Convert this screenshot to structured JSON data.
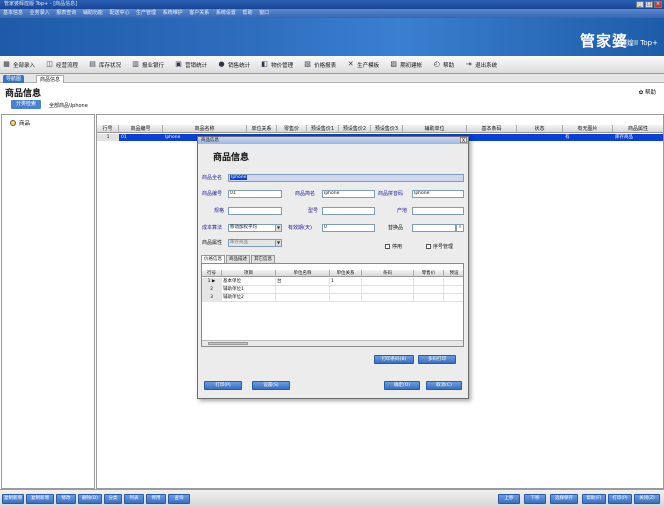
{
  "app": {
    "window_title": "管家婆辉煌版 Top+ - [商品信息]",
    "menu": [
      "基本信息",
      "业务录入",
      "报表查询",
      "辅助功能",
      "配送中心",
      "生产管理",
      "系统维护",
      "客户关系",
      "系统设置",
      "帮助",
      "窗口"
    ],
    "brand": "管家婆",
    "brand_sub": "辉煌II Top+"
  },
  "toolbar": [
    {
      "icon": "storefront-icon",
      "label": "全部录入"
    },
    {
      "icon": "chart-icon",
      "label": "经营流程"
    },
    {
      "icon": "warehouse-icon",
      "label": "库存状况"
    },
    {
      "icon": "ledger-icon",
      "label": "报业银行"
    },
    {
      "icon": "stats-icon",
      "label": "营销统计"
    },
    {
      "icon": "sales-icon",
      "label": "销售统计"
    },
    {
      "icon": "goods-icon",
      "label": "物价管理"
    },
    {
      "icon": "report-icon",
      "label": "价格报表"
    },
    {
      "icon": "tools-icon",
      "label": "生产模板"
    },
    {
      "icon": "calendar-icon",
      "label": "期初建帐"
    },
    {
      "icon": "clock-icon",
      "label": "帮助"
    },
    {
      "icon": "exit-icon",
      "label": "退出系统"
    }
  ],
  "tabs": {
    "home": "导航图",
    "active": "商品信息"
  },
  "page": {
    "title": "商品信息",
    "help": "帮助",
    "category_button": "分类检索",
    "category_path": "全部商品\\Iphone"
  },
  "tree": {
    "root": "商品"
  },
  "grid": {
    "columns": [
      "行号",
      "商品编号",
      "商品名称",
      "单位关系",
      "零售价",
      "预设售价1",
      "预设售价2",
      "预设售价3",
      "辅助单位",
      "基本条码",
      "状态",
      "有无图片",
      "商品属性"
    ],
    "rows": [
      [
        "1",
        "01",
        "Iphone",
        "",
        "",
        "",
        "",
        "",
        "",
        "",
        "",
        "有",
        "库存商品"
      ]
    ]
  },
  "dialog": {
    "titlebar": "商品信息",
    "close": "X",
    "heading": "商品信息",
    "fields": {
      "full_name_label": "商品全名",
      "full_name_value": "Iphone",
      "code_label": "商品编号",
      "code_value": "01",
      "short_name_label": "商品简名",
      "short_name_value": "Iphone",
      "pinyin_label": "商品拼音码",
      "pinyin_value": "Iphone",
      "spec_label": "规格",
      "spec_value": "",
      "model_label": "型号",
      "model_value": "",
      "origin_label": "产地",
      "origin_value": "",
      "cost_method_label": "成本算法",
      "cost_method_value": "移动加权平均",
      "validity_label": "有效期(天)",
      "validity_value": "0",
      "substitute_label": "替换品",
      "substitute_value": "",
      "attribute_label": "商品属性",
      "attribute_value": "库存商品",
      "disabled_label": "停用",
      "serial_label": "序号管理"
    },
    "tabs": [
      "价格信息",
      "商品描述",
      "其它信息"
    ],
    "subgrid": {
      "columns": [
        "行号",
        "项目",
        "单位名称",
        "单位关系",
        "条码",
        "零售价",
        "预设"
      ],
      "rows": [
        [
          "1",
          "基本单位",
          "台",
          "1",
          "",
          "",
          ""
        ],
        [
          "2",
          "辅助单位1",
          "",
          "",
          "",
          "",
          ""
        ],
        [
          "3",
          "辅助单位2",
          "",
          "",
          "",
          "",
          ""
        ]
      ]
    },
    "buttons": {
      "print_barcode": "打印条码(B)",
      "multi_barcode": "多码打印",
      "print": "打印(P)",
      "settings": "设置(S)",
      "ok": "确定(O)",
      "cancel": "取消(C)"
    }
  },
  "statusbar": {
    "left_buttons": [
      "复制新增",
      "复制新增",
      "修改",
      "删除(D)",
      "分类",
      "列表",
      "停用",
      "查询"
    ],
    "right_buttons": [
      "上移",
      "下移",
      "选择保存",
      "帮助(F)",
      "打印(P)",
      "关闭(Z)"
    ]
  }
}
